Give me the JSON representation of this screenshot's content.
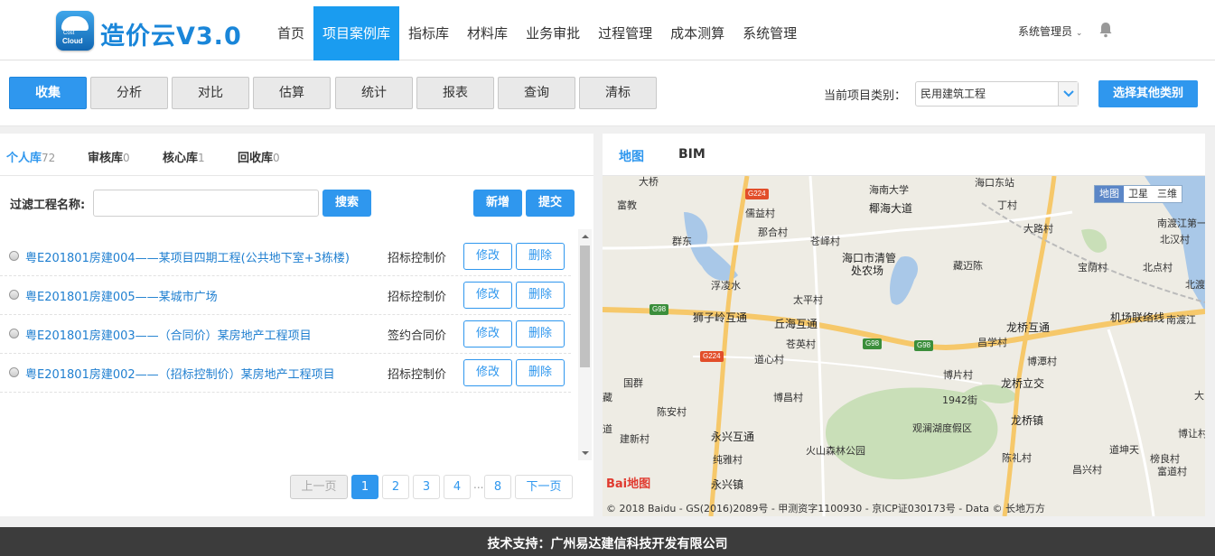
{
  "header": {
    "brand": "造价云V3.0",
    "logo_text_top": "Cost",
    "logo_text_bottom": "Cloud",
    "nav": [
      "首页",
      "项目案例库",
      "指标库",
      "材料库",
      "业务审批",
      "过程管理",
      "成本测算",
      "系统管理"
    ],
    "active_nav": "项目案例库",
    "user": "系统管理员",
    "accent": "#1a9cf0"
  },
  "toolbar": {
    "buttons": [
      "收集",
      "分析",
      "对比",
      "估算",
      "统计",
      "报表",
      "查询",
      "清标"
    ],
    "active_button": "收集",
    "category_label": "当前项目类别：",
    "category_value": "民用建筑工程",
    "select_other": "选择其他类别"
  },
  "left": {
    "tabs": [
      {
        "label": "个人库",
        "count": "72"
      },
      {
        "label": "审核库",
        "count": "0"
      },
      {
        "label": "核心库",
        "count": "1"
      },
      {
        "label": "回收库",
        "count": "0"
      }
    ],
    "active_tab": "个人库",
    "filter_label": "过滤工程名称:",
    "filter_value": "",
    "search_label": "搜索",
    "add_label": "新增",
    "submit_label": "提交",
    "rows": [
      {
        "title": "粤E201801房建004——某项目四期工程(公共地下室+3栋楼)",
        "price": "招标控制价",
        "edit": "修改",
        "delete": "删除"
      },
      {
        "title": "粤E201801房建005——某城市广场",
        "price": "招标控制价",
        "edit": "修改",
        "delete": "删除"
      },
      {
        "title": "粤E201801房建003——（合同价）某房地产工程项目",
        "price": "签约合同价",
        "edit": "修改",
        "delete": "删除"
      },
      {
        "title": "粤E201801房建002——（招标控制价）某房地产工程项目",
        "price": "招标控制价",
        "edit": "修改",
        "delete": "删除"
      }
    ],
    "pager": {
      "prev": "上一页",
      "pages": [
        "1",
        "2",
        "3",
        "4"
      ],
      "dots": "...",
      "last": "8",
      "next": "下一页",
      "current": "1"
    }
  },
  "right": {
    "tabs": [
      "地图",
      "BIM"
    ],
    "active_tab": "地图",
    "map_types": [
      "地图",
      "卫星",
      "三维"
    ],
    "active_map_type": "地图",
    "labels": {
      "l1": "大桥",
      "l2": "富教",
      "l3": "儒益村",
      "l4": "海南大学",
      "l5": "椰海大道",
      "l6": "海口东站",
      "l7": "丁村",
      "l8": "大路村",
      "l9": "南渡江第一",
      "l10": "北汉村",
      "l11": "群东",
      "l12": "那合村",
      "l13": "苍峄村",
      "l14": "海口市清管",
      "l15": "处农场",
      "l16": "藏迈陈",
      "l17": "宝荫村",
      "l18": "北点村",
      "l19": "北渡",
      "l20": "浮凌水",
      "l21": "太平村",
      "l22": "狮子岭互通",
      "l23": "丘海互通",
      "l24": "龙桥互通",
      "l25": "机场联络线",
      "l26": "南渡江",
      "l27": "苍英村",
      "l28": "昌学村",
      "l29": "道心村",
      "l30": "博片村",
      "l31": "博潭村",
      "l32": "国群",
      "l33": "陈安村",
      "l34": "博昌村",
      "l35": "1942街",
      "l36": "龙桥立交",
      "l37": "藏",
      "l38": "观澜湖度假区",
      "l39": "龙桥镇",
      "l40": "建新村",
      "l41": "永兴互通",
      "l42": "火山森林公园",
      "l43": "道坤天",
      "l44": "博让村",
      "l45": "纯雅村",
      "l46": "陈礼村",
      "l47": "榜良村",
      "l48": "昌兴村",
      "l49": "富道村",
      "l50": "永兴镇",
      "l51": "大",
      "l52": "道"
    },
    "shields": {
      "s1": "G224",
      "s2": "G98",
      "s3": "G224",
      "s4": "G98",
      "s5": "G98"
    },
    "baidu_logo": "Bai地图",
    "copyright": "© 2018 Baidu - GS(2016)2089号 - 甲测资字1100930 - 京ICP证030173号 - Data © 长地万方"
  },
  "footer": {
    "text": "技术支持：广州易达建信科技开发有限公司"
  }
}
